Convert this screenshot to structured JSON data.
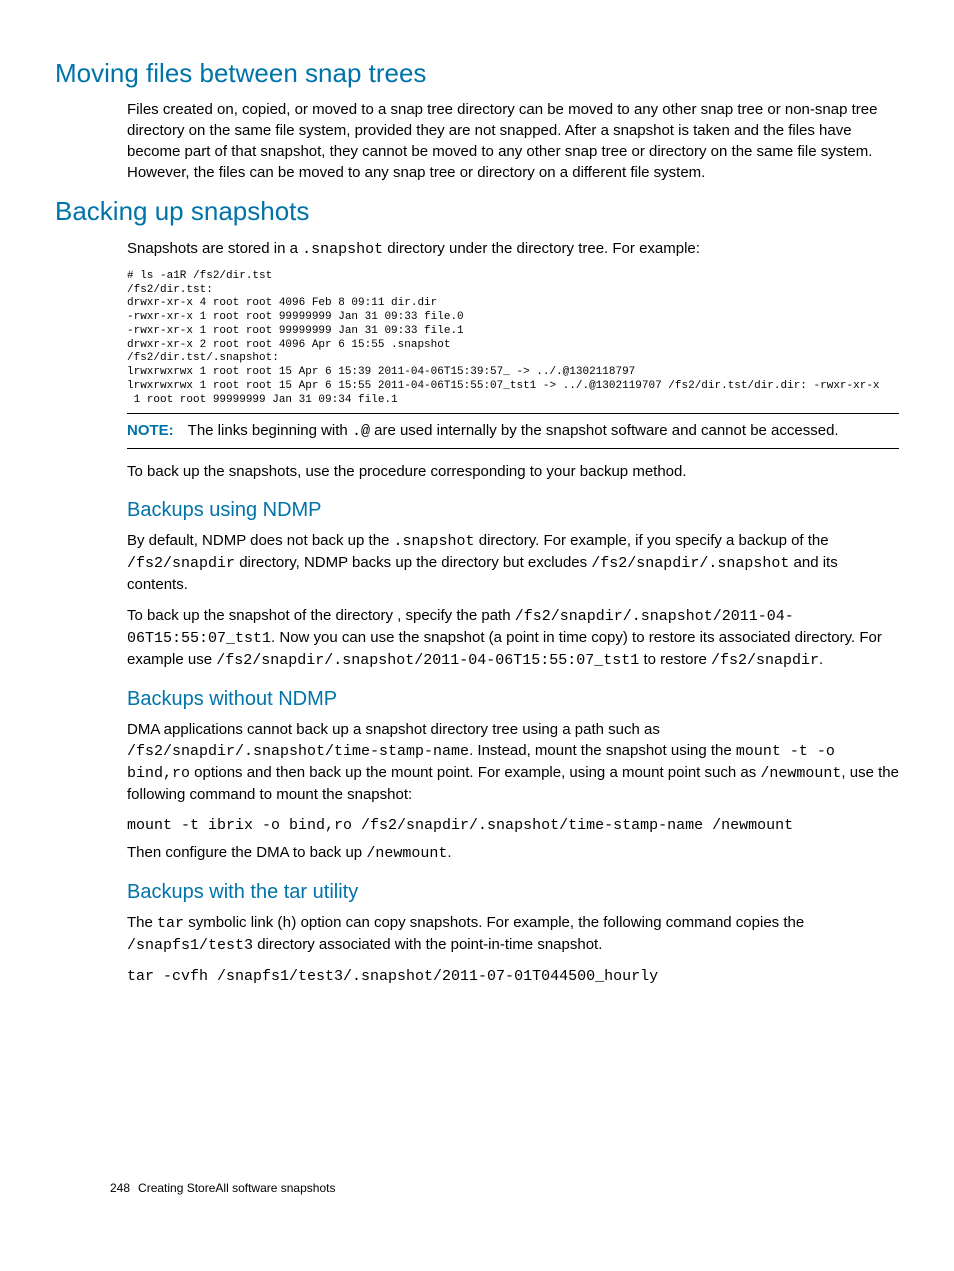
{
  "h1_moving": "Moving files between snap trees",
  "p_moving": "Files created on, copied, or moved to a snap tree directory can be moved to any other snap tree or non-snap tree directory on the same file system, provided they are not snapped. After a snapshot is taken and the files have become part of that snapshot, they cannot be moved to any other snap tree or directory on the same file system. However, the files can be moved to any snap tree or directory on a different file system.",
  "h1_backing": "Backing up snapshots",
  "p_backing_intro_a": "Snapshots are stored in a ",
  "code_snapshot_dir": ".snapshot",
  "p_backing_intro_b": " directory under the directory tree. For example:",
  "ls_output": "# ls -a1R /fs2/dir.tst\n/fs2/dir.tst:\ndrwxr-xr-x 4 root root 4096 Feb 8 09:11 dir.dir\n-rwxr-xr-x 1 root root 99999999 Jan 31 09:33 file.0\n-rwxr-xr-x 1 root root 99999999 Jan 31 09:33 file.1\ndrwxr-xr-x 2 root root 4096 Apr 6 15:55 .snapshot\n/fs2/dir.tst/.snapshot:\nlrwxrwxrwx 1 root root 15 Apr 6 15:39 2011-04-06T15:39:57_ -> ../.@1302118797\nlrwxrwxrwx 1 root root 15 Apr 6 15:55 2011-04-06T15:55:07_tst1 -> ../.@1302119707 /fs2/dir.tst/dir.dir: -rwxr-xr-x\n 1 root root 99999999 Jan 31 09:34 file.1",
  "note_label": "NOTE:",
  "note_a": "The links beginning with ",
  "note_code": ".@",
  "note_b": " are used internally by the snapshot software and cannot be accessed.",
  "p_backup_method": "To back up the snapshots, use the procedure corresponding to your backup method.",
  "h2_ndmp": "Backups using NDMP",
  "ndmp_p1_a": "By default, NDMP does not back up the ",
  "ndmp_p1_b": " directory. For example, if you specify a backup of the ",
  "code_fs2_snapdir": "/fs2/snapdir",
  "ndmp_p1_c": " directory, NDMP backs up the directory but excludes ",
  "code_fs2_snapdir_snap": "/fs2/snapdir/.snapshot",
  "ndmp_p1_d": " and its contents.",
  "ndmp_p2_a": "To back up the snapshot of the directory , specify the path ",
  "code_snap_path_full": "/fs2/snapdir/.snapshot/2011-04-06T15:55:07_tst1",
  "ndmp_p2_b": ". Now you can use the snapshot (a point in time copy) to restore its associated directory. For example use ",
  "ndmp_p2_c": " to restore ",
  "ndmp_p2_d": ".",
  "h2_without": "Backups without NDMP",
  "without_p1_a": "DMA applications cannot back up a snapshot directory tree using a path such as ",
  "code_without_path": "/fs2/snapdir/.snapshot/time-stamp-name",
  "without_p1_b": ". Instead, mount the snapshot using the ",
  "code_mount_opts": "mount -t -o bind,ro",
  "without_p1_c": " options and then back up the mount point. For example, using a mount point such as ",
  "code_newmount": "/newmount",
  "without_p1_d": ", use the following command to mount the snapshot:",
  "mount_cmd": "mount -t ibrix -o bind,ro /fs2/snapdir/.snapshot/time-stamp-name /newmount",
  "without_p2_a": "Then configure the DMA to back up ",
  "without_p2_b": ".",
  "h2_tar": "Backups with the tar utility",
  "tar_p1_a": "The ",
  "code_tar": "tar",
  "tar_p1_b": " symbolic link (",
  "code_h": "h",
  "tar_p1_c": ") option can copy snapshots. For example, the following command copies the ",
  "code_snapfs_test3": "/snapfs1/test3",
  "tar_p1_d": " directory associated with the point-in-time snapshot.",
  "tar_cmd": "tar -cvfh /snapfs1/test3/.snapshot/2011-07-01T044500_hourly",
  "footer_page": "248",
  "footer_text": "Creating StoreAll software snapshots"
}
